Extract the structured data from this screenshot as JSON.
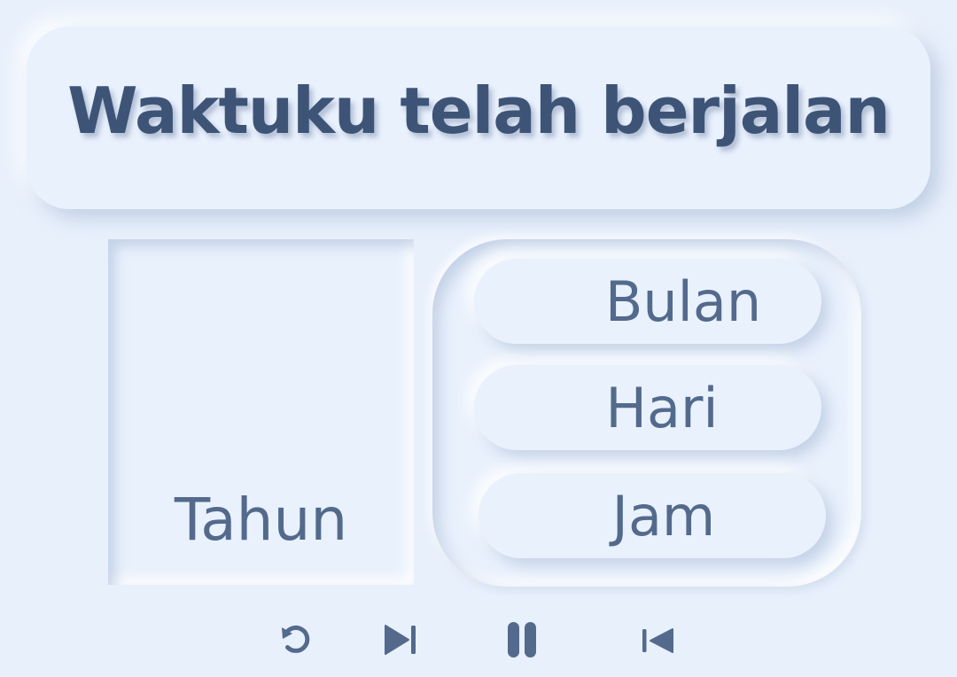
{
  "header": {
    "title": "Waktuku telah berjalan"
  },
  "counters": {
    "year_label": "Tahun",
    "month_label": "Bulan",
    "day_label": "Hari",
    "hour_label": "Jam"
  },
  "controls": [
    {
      "icon": "restart-icon"
    },
    {
      "icon": "skip-next-icon"
    },
    {
      "icon": "pause-icon"
    },
    {
      "icon": "skip-previous-icon"
    }
  ],
  "colors": {
    "background": "#e8f0fc",
    "title_text": "#3e5477",
    "label_text": "#536a8c"
  }
}
